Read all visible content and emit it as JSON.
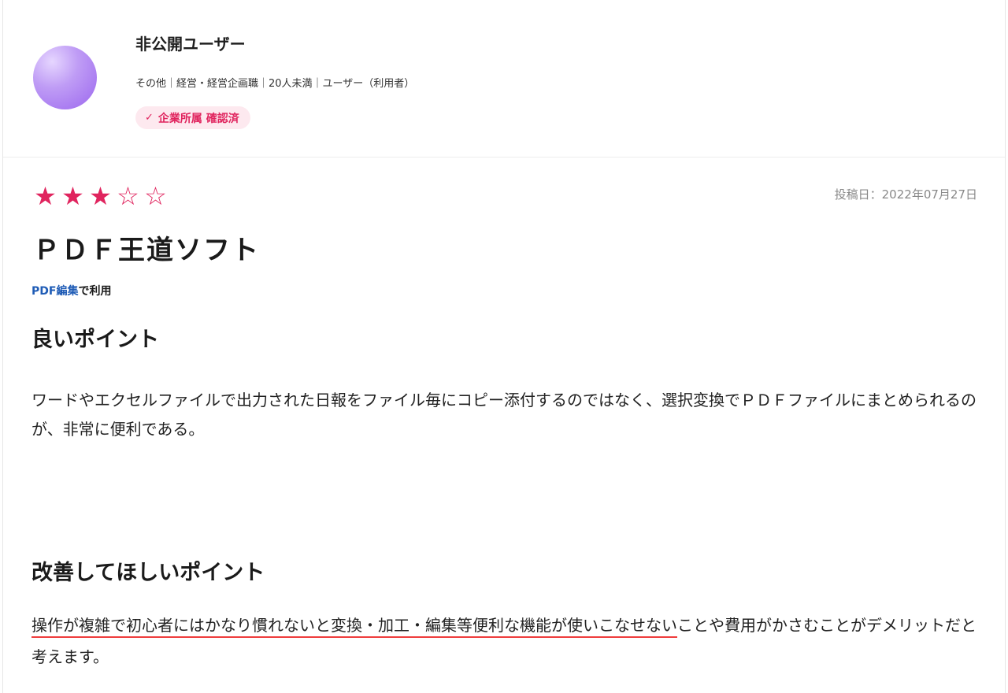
{
  "user": {
    "name": "非公開ユーザー",
    "meta": "その他｜経営・経営企画職｜20人未満｜ユーザー（利用者）",
    "badge_icon": "check-icon",
    "badge_label": "企業所属 確認済"
  },
  "review": {
    "rating": 3,
    "rating_max": 5,
    "post_date": "投稿日：2022年07月27日",
    "title": "ＰＤＦ王道ソフト",
    "usage_category": "PDF編集",
    "usage_suffix": "で利用",
    "good_heading": "良いポイント",
    "good_text": "ワードやエクセルファイルで出力された日報をファイル毎にコピー添付するのではなく、選択変換でＰＤＦファイルにまとめられるのが、非常に便利である。",
    "bad_heading": "改善してほしいポイント",
    "bad_text_underlined": "操作が複雑で初心者にはかなり慣れないと変換・加工・編集等便利な機能が使いこなせない",
    "bad_text_rest": "ことや費用がかさむことがデメリットだと考えます。"
  },
  "colors": {
    "accent": "#e0245e",
    "link": "#1f5cb6",
    "underline": "#ef3c3c",
    "badge_bg": "#fde9ef"
  }
}
